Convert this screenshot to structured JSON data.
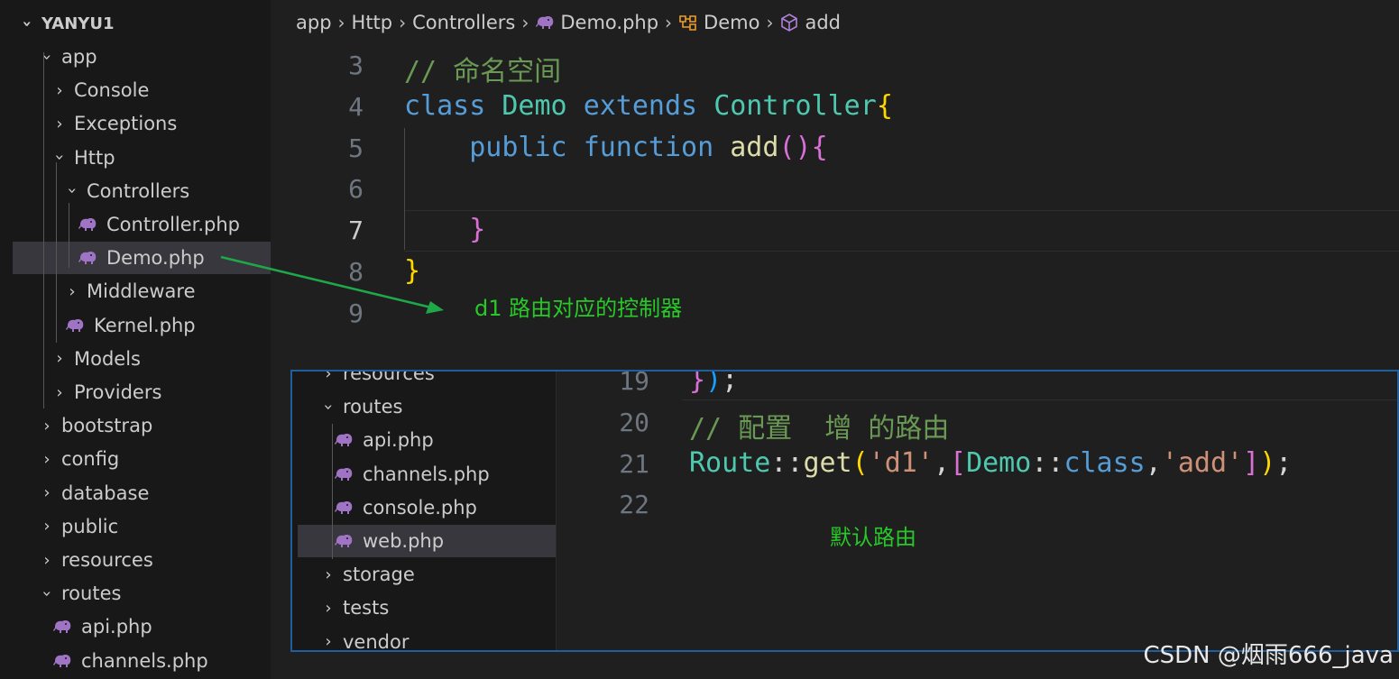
{
  "explorer": {
    "root": "YANYU1",
    "items": [
      {
        "label": "app",
        "type": "folder",
        "open": true,
        "depth": 1
      },
      {
        "label": "Console",
        "type": "folder",
        "open": false,
        "depth": 2
      },
      {
        "label": "Exceptions",
        "type": "folder",
        "open": false,
        "depth": 2
      },
      {
        "label": "Http",
        "type": "folder",
        "open": true,
        "depth": 2
      },
      {
        "label": "Controllers",
        "type": "folder",
        "open": true,
        "depth": 3
      },
      {
        "label": "Controller.php",
        "type": "php",
        "depth": 4
      },
      {
        "label": "Demo.php",
        "type": "php",
        "depth": 4,
        "selected": true
      },
      {
        "label": "Middleware",
        "type": "folder",
        "open": false,
        "depth": 3
      },
      {
        "label": "Kernel.php",
        "type": "php",
        "depth": 3
      },
      {
        "label": "Models",
        "type": "folder",
        "open": false,
        "depth": 2
      },
      {
        "label": "Providers",
        "type": "folder",
        "open": false,
        "depth": 2
      },
      {
        "label": "bootstrap",
        "type": "folder",
        "open": false,
        "depth": 1
      },
      {
        "label": "config",
        "type": "folder",
        "open": false,
        "depth": 1
      },
      {
        "label": "database",
        "type": "folder",
        "open": false,
        "depth": 1
      },
      {
        "label": "public",
        "type": "folder",
        "open": false,
        "depth": 1
      },
      {
        "label": "resources",
        "type": "folder",
        "open": false,
        "depth": 1
      },
      {
        "label": "routes",
        "type": "folder",
        "open": true,
        "depth": 1
      },
      {
        "label": "api.php",
        "type": "php",
        "depth": 2
      },
      {
        "label": "channels.php",
        "type": "php",
        "depth": 2
      }
    ]
  },
  "breadcrumb": {
    "items": [
      {
        "label": "app",
        "icon": ""
      },
      {
        "label": "Http",
        "icon": ""
      },
      {
        "label": "Controllers",
        "icon": ""
      },
      {
        "label": "Demo.php",
        "icon": "php-elephant-icon"
      },
      {
        "label": "Demo",
        "icon": "class-icon"
      },
      {
        "label": "add",
        "icon": "method-cube-icon"
      }
    ]
  },
  "editor_top": {
    "lines": [
      {
        "n": "3",
        "tokens": [
          {
            "t": "// 命名空间",
            "c": "c-com"
          }
        ]
      },
      {
        "n": "4",
        "tokens": [
          {
            "t": "class",
            "c": "c-kw"
          },
          {
            "t": " ",
            "c": "c-pl"
          },
          {
            "t": "Demo",
            "c": "c-cls"
          },
          {
            "t": " ",
            "c": "c-pl"
          },
          {
            "t": "extends",
            "c": "c-kw"
          },
          {
            "t": " ",
            "c": "c-pl"
          },
          {
            "t": "Controller",
            "c": "c-cls"
          },
          {
            "t": "{",
            "c": "c-b1"
          }
        ]
      },
      {
        "n": "5",
        "tokens": [
          {
            "t": "    ",
            "c": "c-pl"
          },
          {
            "t": "public",
            "c": "c-kw"
          },
          {
            "t": " ",
            "c": "c-pl"
          },
          {
            "t": "function",
            "c": "c-kw"
          },
          {
            "t": " ",
            "c": "c-pl"
          },
          {
            "t": "add",
            "c": "c-fn"
          },
          {
            "t": "()",
            "c": "c-b2"
          },
          {
            "t": "{",
            "c": "c-b2"
          }
        ]
      },
      {
        "n": "6",
        "tokens": []
      },
      {
        "n": "7",
        "tokens": [
          {
            "t": "    ",
            "c": "c-pl"
          },
          {
            "t": "}",
            "c": "c-b2"
          }
        ],
        "active": true
      },
      {
        "n": "8",
        "tokens": [
          {
            "t": "}",
            "c": "c-b1"
          }
        ]
      },
      {
        "n": "9",
        "tokens": []
      }
    ]
  },
  "annotations": {
    "controller_note": "d1 路由对应的控制器",
    "default_route_note": "默认路由"
  },
  "inset": {
    "explorer_items": [
      {
        "label": "resources",
        "type": "folder",
        "open": false,
        "depth": 1,
        "partial": true
      },
      {
        "label": "routes",
        "type": "folder",
        "open": true,
        "depth": 1
      },
      {
        "label": "api.php",
        "type": "php",
        "depth": 2
      },
      {
        "label": "channels.php",
        "type": "php",
        "depth": 2
      },
      {
        "label": "console.php",
        "type": "php",
        "depth": 2
      },
      {
        "label": "web.php",
        "type": "php",
        "depth": 2,
        "selected": true
      },
      {
        "label": "storage",
        "type": "folder",
        "open": false,
        "depth": 1
      },
      {
        "label": "tests",
        "type": "folder",
        "open": false,
        "depth": 1
      },
      {
        "label": "vendor",
        "type": "folder",
        "open": false,
        "depth": 1
      }
    ],
    "lines": [
      {
        "n": "19",
        "tokens": [
          {
            "t": "}",
            "c": "c-b2"
          },
          {
            "t": ")",
            "c": "c-b3"
          },
          {
            "t": ";",
            "c": "c-pl"
          }
        ]
      },
      {
        "n": "20",
        "tokens": [
          {
            "t": "// 配置  增 的路由",
            "c": "c-com"
          }
        ]
      },
      {
        "n": "21",
        "tokens": [
          {
            "t": "Route",
            "c": "c-cls"
          },
          {
            "t": "::",
            "c": "c-pl"
          },
          {
            "t": "get",
            "c": "c-fn"
          },
          {
            "t": "(",
            "c": "c-b1"
          },
          {
            "t": "'d1'",
            "c": "c-str"
          },
          {
            "t": ",",
            "c": "c-pl"
          },
          {
            "t": "[",
            "c": "c-b2"
          },
          {
            "t": "Demo",
            "c": "c-cls"
          },
          {
            "t": "::",
            "c": "c-pl"
          },
          {
            "t": "class",
            "c": "c-kw"
          },
          {
            "t": ",",
            "c": "c-pl"
          },
          {
            "t": "'add'",
            "c": "c-str"
          },
          {
            "t": "]",
            "c": "c-b2"
          },
          {
            "t": ")",
            "c": "c-b1"
          },
          {
            "t": ";",
            "c": "c-pl"
          }
        ]
      },
      {
        "n": "22",
        "tokens": []
      }
    ]
  },
  "watermark": "CSDN @烟雨666_java",
  "colors": {
    "annotation_green": "#28c828",
    "arrow_green": "#1fa84a",
    "php_icon": "#a074c4",
    "inset_border": "#1f5f9f"
  }
}
